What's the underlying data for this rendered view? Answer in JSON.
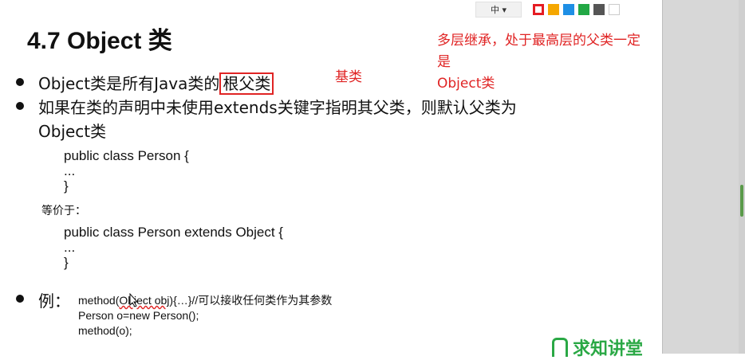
{
  "toolbar": {
    "ime_label": "中 ▾"
  },
  "slide": {
    "title": "4.7  Object 类",
    "note_line1": "多层继承，处于最高层的父类一定是",
    "note_line2": "Object类",
    "annotation": "基类",
    "bullet1_prefix": "Object类是所有Java类的",
    "bullet1_boxed": "根父类",
    "bullet2_line1": "如果在类的声明中未使用extends关键字指明其父类，则默认父类为",
    "bullet2_line2": "Object类",
    "code1": [
      "public class Person {",
      "...",
      "}"
    ],
    "equiv": "等价于：",
    "code2": [
      "public class Person extends Object {",
      "...",
      "}"
    ],
    "example_label": "例：",
    "example_line1a": "method(",
    "example_line1b": "Object obj",
    "example_line1c": "){…}//可以接收任何类作为其参数",
    "example_line2": "Person o=new Person();",
    "example_line3": "method(o);",
    "logo_text": "求知讲堂"
  },
  "colors": {
    "accent_red": "#e02424",
    "logo_green": "#2aa845"
  }
}
